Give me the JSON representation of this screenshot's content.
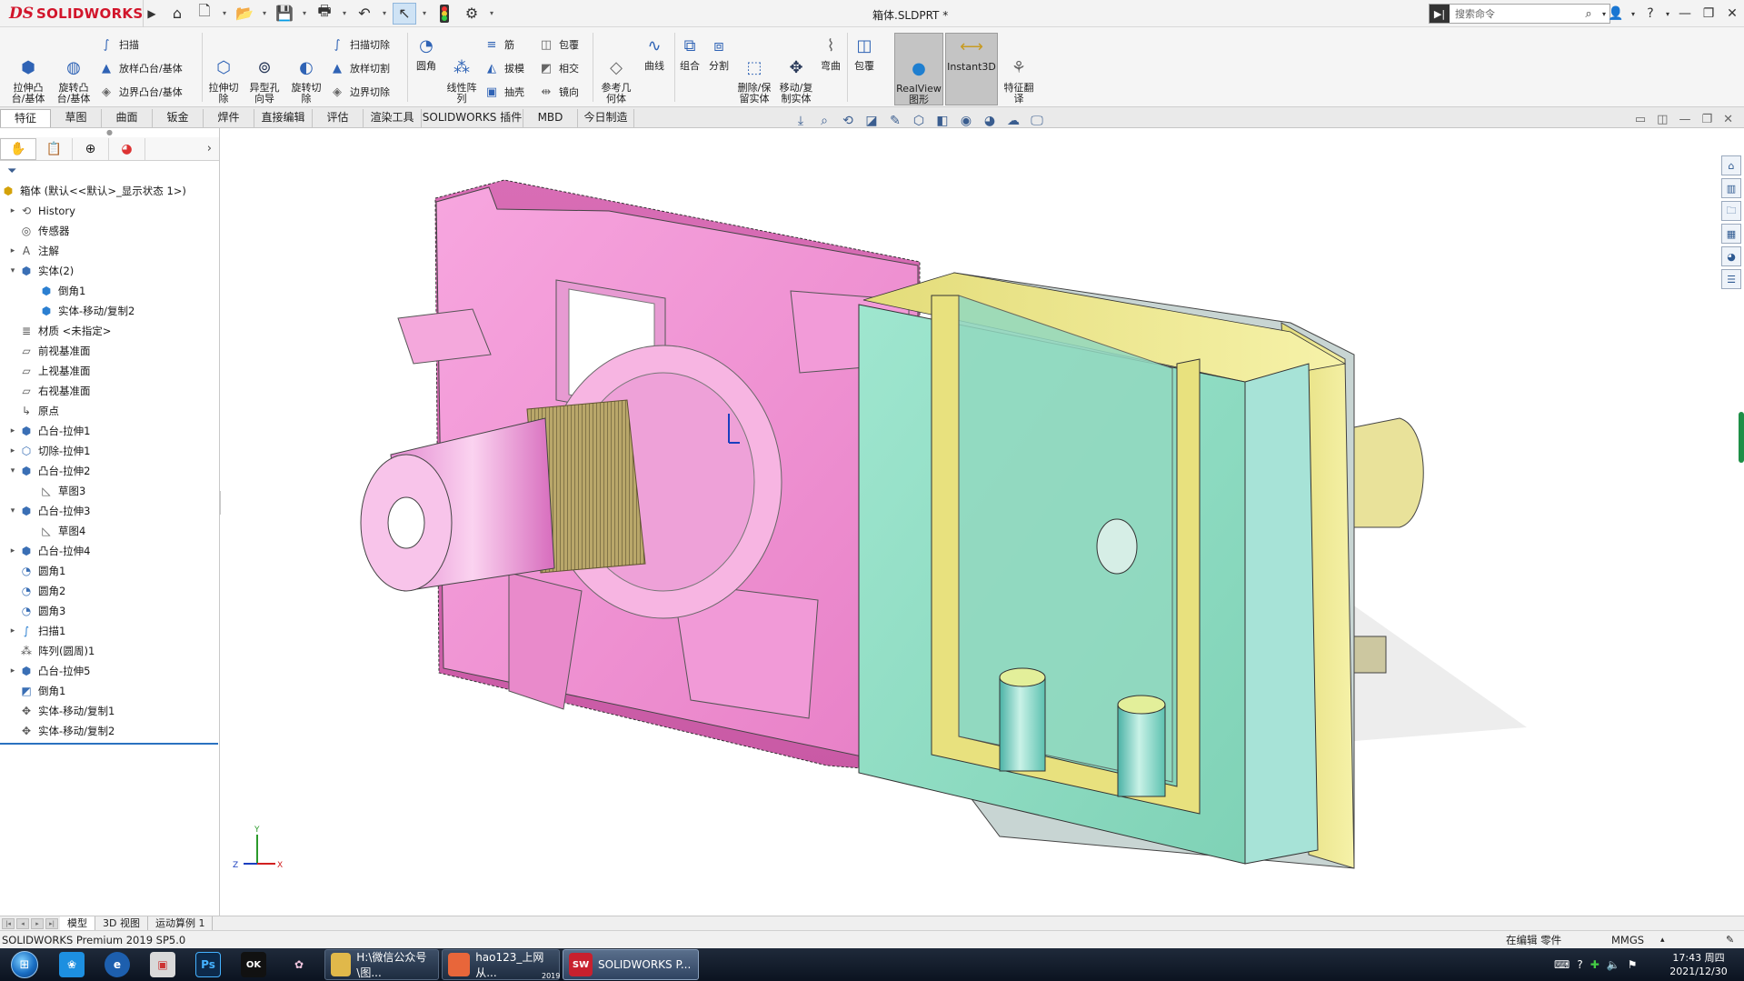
{
  "app": {
    "logo_ds": "DS",
    "logo_name": "SOLIDWORKS",
    "document_title": "箱体.SLDPRT *",
    "search_placeholder": "搜索命令"
  },
  "quick_access": [
    "home-icon",
    "new-icon",
    "open-icon",
    "save-icon",
    "print-icon",
    "undo-icon",
    "select-icon",
    "traffic-light-icon",
    "options-icon"
  ],
  "ribbon": {
    "extrude_boss": "拉伸凸\n台/基体",
    "revolve_boss": "旋转凸\n台/基体",
    "sweep": "扫描",
    "loft_boss": "放样凸台/基体",
    "boundary_boss": "边界凸台/基体",
    "extrude_cut": "拉伸切\n除",
    "hole_wizard": "异型孔\n向导",
    "revolve_cut": "旋转切\n除",
    "swept_cut": "扫描切除",
    "lofted_cut": "放样切割",
    "boundary_cut": "边界切除",
    "fillet": "圆角",
    "linear_pattern": "线性阵\n列",
    "rib": "筋",
    "draft": "拔模",
    "shell": "抽壳",
    "wrap": "包覆",
    "intersect": "相交",
    "mirror": "镜向",
    "ref_geometry": "参考几\n何体",
    "curves": "曲线",
    "combine": "组合",
    "split": "分割",
    "delete_keep_body": "删除/保\n留实体",
    "move_copy_body": "移动/复\n制实体",
    "flex": "弯曲",
    "wrap2": "包覆",
    "realview": "RealView\n图形",
    "instant3d": "Instant3D",
    "feature_translate": "特征翻\n译"
  },
  "tabs": [
    "特征",
    "草图",
    "曲面",
    "钣金",
    "焊件",
    "直接编辑",
    "评估",
    "渲染工具",
    "SOLIDWORKS 插件",
    "MBD",
    "今日制造"
  ],
  "tree": {
    "root": "箱体  (默认<<默认>_显示状态 1>)",
    "items": [
      {
        "label": "History",
        "icon": "history-icon",
        "exp": "▸",
        "indent": 0
      },
      {
        "label": "传感器",
        "icon": "sensor-icon",
        "exp": "",
        "indent": 0
      },
      {
        "label": "注解",
        "icon": "annotation-icon",
        "exp": "▸",
        "indent": 0
      },
      {
        "label": "实体(2)",
        "icon": "solid-bodies-icon",
        "exp": "▾",
        "indent": 0
      },
      {
        "label": "倒角1",
        "icon": "body-icon",
        "exp": "",
        "indent": 1
      },
      {
        "label": "实体-移动/复制2",
        "icon": "body-icon",
        "exp": "",
        "indent": 1
      },
      {
        "label": "材质 <未指定>",
        "icon": "material-icon",
        "exp": "",
        "indent": 0
      },
      {
        "label": "前视基准面",
        "icon": "plane-icon",
        "exp": "",
        "indent": 0
      },
      {
        "label": "上视基准面",
        "icon": "plane-icon",
        "exp": "",
        "indent": 0
      },
      {
        "label": "右视基准面",
        "icon": "plane-icon",
        "exp": "",
        "indent": 0
      },
      {
        "label": "原点",
        "icon": "origin-icon",
        "exp": "",
        "indent": 0
      },
      {
        "label": "凸台-拉伸1",
        "icon": "extrude-icon",
        "exp": "▸",
        "indent": 0
      },
      {
        "label": "切除-拉伸1",
        "icon": "cut-icon",
        "exp": "▸",
        "indent": 0
      },
      {
        "label": "凸台-拉伸2",
        "icon": "extrude-icon",
        "exp": "▾",
        "indent": 0
      },
      {
        "label": "草图3",
        "icon": "sketch-icon",
        "exp": "",
        "indent": 1
      },
      {
        "label": "凸台-拉伸3",
        "icon": "extrude-icon",
        "exp": "▾",
        "indent": 0
      },
      {
        "label": "草图4",
        "icon": "sketch-icon",
        "exp": "",
        "indent": 1
      },
      {
        "label": "凸台-拉伸4",
        "icon": "extrude-icon",
        "exp": "▸",
        "indent": 0
      },
      {
        "label": "圆角1",
        "icon": "fillet-icon",
        "exp": "",
        "indent": 0
      },
      {
        "label": "圆角2",
        "icon": "fillet-icon",
        "exp": "",
        "indent": 0
      },
      {
        "label": "圆角3",
        "icon": "fillet-icon",
        "exp": "",
        "indent": 0
      },
      {
        "label": "扫描1",
        "icon": "sweep-icon",
        "exp": "▸",
        "indent": 0
      },
      {
        "label": "阵列(圆周)1",
        "icon": "pattern-icon",
        "exp": "",
        "indent": 0
      },
      {
        "label": "凸台-拉伸5",
        "icon": "extrude-icon",
        "exp": "▸",
        "indent": 0
      },
      {
        "label": "倒角1",
        "icon": "chamfer-icon",
        "exp": "",
        "indent": 0
      },
      {
        "label": "实体-移动/复制1",
        "icon": "move-body-icon",
        "exp": "",
        "indent": 0
      },
      {
        "label": "实体-移动/复制2",
        "icon": "move-body-icon",
        "exp": "",
        "indent": 0
      }
    ]
  },
  "triad": {
    "x": "X",
    "y": "Y",
    "z": "Z"
  },
  "bottom_tabs": [
    "模型",
    "3D 视图",
    "运动算例 1"
  ],
  "status": {
    "left": "SOLIDWORKS Premium 2019 SP5.0",
    "editing": "在编辑 零件",
    "units": "MMGS",
    "arrow": "▴"
  },
  "taskbar": {
    "tasks": [
      {
        "label": "H:\\微信公众号\\图...",
        "icon_color": "#e0b84a",
        "icon_text": ""
      },
      {
        "label": "hao123_上网从...",
        "icon_color": "#e8663a",
        "icon_text": ""
      },
      {
        "label": "SOLIDWORKS P...",
        "icon_color": "#c8202e",
        "icon_text": "SW",
        "sub": "2019"
      }
    ],
    "time": "17:43 周四",
    "date": "2021/12/30"
  },
  "colors": {
    "pink_body": "#ef8ed0",
    "green_body": "#93ddc2",
    "yellow_edge": "#efe98a",
    "accent_red": "#d2152b",
    "tree_end_line": "#2a72c0"
  }
}
